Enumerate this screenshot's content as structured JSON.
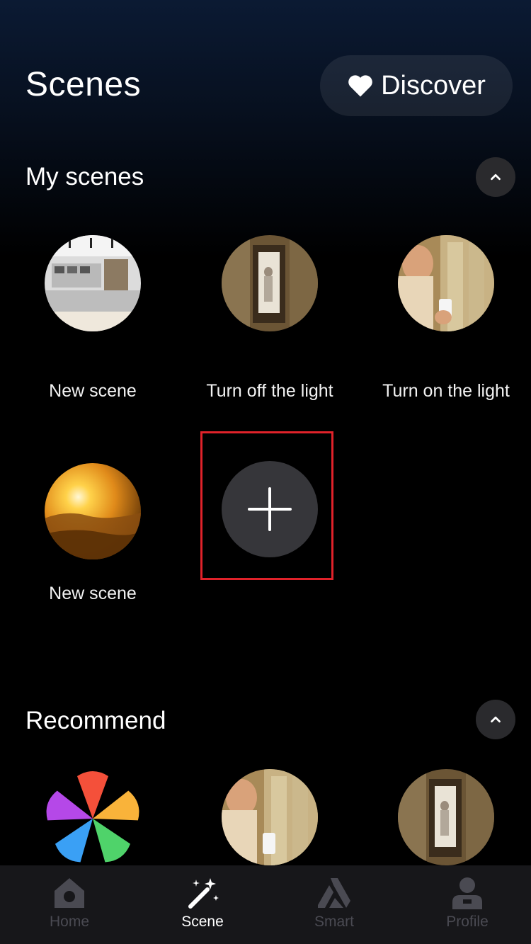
{
  "header": {
    "title": "Scenes",
    "discover_label": "Discover"
  },
  "my_scenes": {
    "title": "My scenes",
    "items": [
      {
        "label": "New scene",
        "image": "kitchen-photo"
      },
      {
        "label": "Turn off the light",
        "image": "doorway-photo"
      },
      {
        "label": "Turn on the light",
        "image": "person-phone-photo"
      },
      {
        "label": "New scene",
        "image": "sunset-photo"
      }
    ],
    "add_label": "+"
  },
  "recommend": {
    "title": "Recommend",
    "items": [
      {
        "image": "color-petals-icon"
      },
      {
        "image": "person-phone-photo"
      },
      {
        "image": "doorway-photo"
      }
    ]
  },
  "tabbar": {
    "tabs": [
      {
        "label": "Home",
        "icon": "home-icon",
        "active": false
      },
      {
        "label": "Scene",
        "icon": "magic-wand-icon",
        "active": true
      },
      {
        "label": "Smart",
        "icon": "smart-triangle-icon",
        "active": false
      },
      {
        "label": "Profile",
        "icon": "profile-icon",
        "active": false
      }
    ]
  },
  "colors": {
    "highlight_border": "#e0222a",
    "background": "#000000",
    "tabbar": "#17171a"
  }
}
